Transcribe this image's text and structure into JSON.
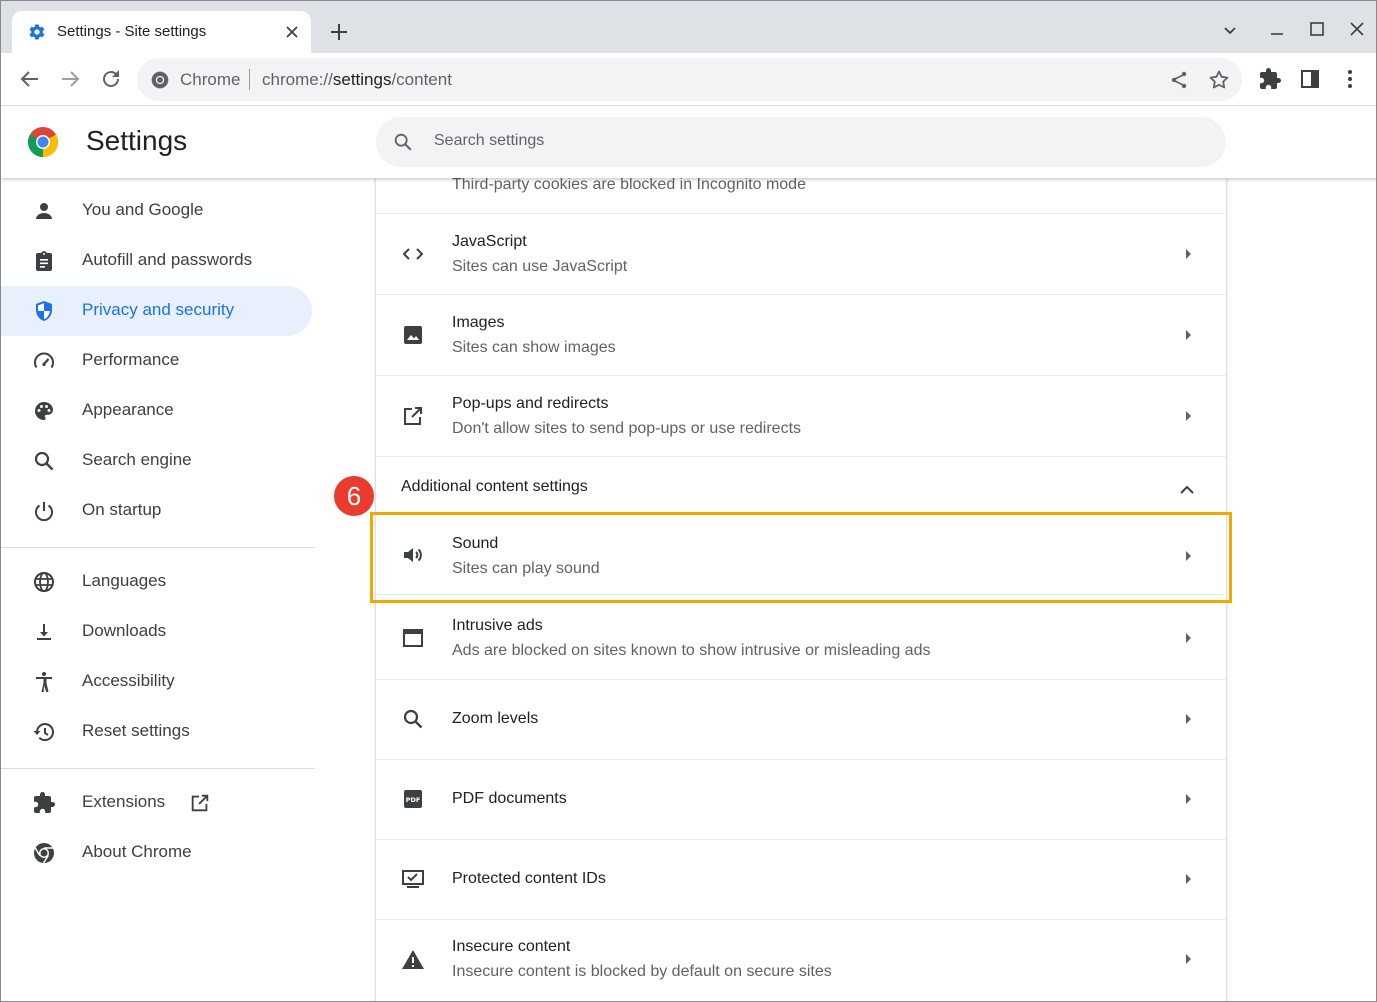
{
  "browser": {
    "tab_title": "Settings - Site settings",
    "omnibox_chip": "Chrome",
    "url_scheme": "chrome://",
    "url_host": "settings",
    "url_path": "/content"
  },
  "header": {
    "title": "Settings",
    "search_placeholder": "Search settings"
  },
  "sidebar": {
    "items": [
      {
        "label": "You and Google",
        "icon": "person-icon"
      },
      {
        "label": "Autofill and passwords",
        "icon": "clipboard-icon"
      },
      {
        "label": "Privacy and security",
        "icon": "shield-icon",
        "active": true
      },
      {
        "label": "Performance",
        "icon": "speedometer-icon"
      },
      {
        "label": "Appearance",
        "icon": "palette-icon"
      },
      {
        "label": "Search engine",
        "icon": "search-icon"
      },
      {
        "label": "On startup",
        "icon": "power-icon"
      },
      {
        "label": "Languages",
        "icon": "globe-icon"
      },
      {
        "label": "Downloads",
        "icon": "download-icon"
      },
      {
        "label": "Accessibility",
        "icon": "accessibility-icon"
      },
      {
        "label": "Reset settings",
        "icon": "restore-icon"
      },
      {
        "label": "Extensions",
        "icon": "puzzle-icon"
      },
      {
        "label": "About Chrome",
        "icon": "chrome-icon"
      }
    ]
  },
  "content": {
    "partial_row_sub": "Third-party cookies are blocked in Incognito mode",
    "rows": [
      {
        "title": "JavaScript",
        "sub": "Sites can use JavaScript",
        "icon": "code-icon"
      },
      {
        "title": "Images",
        "sub": "Sites can show images",
        "icon": "image-icon"
      },
      {
        "title": "Pop-ups and redirects",
        "sub": "Don't allow sites to send pop-ups or use redirects",
        "icon": "open-in-new-icon"
      }
    ],
    "section_title": "Additional content settings",
    "additional_rows": [
      {
        "title": "Sound",
        "sub": "Sites can play sound",
        "icon": "volume-icon"
      },
      {
        "title": "Intrusive ads",
        "sub": "Ads are blocked on sites known to show intrusive or misleading ads",
        "icon": "web-asset-icon"
      },
      {
        "title": "Zoom levels",
        "sub": "",
        "icon": "zoom-icon"
      },
      {
        "title": "PDF documents",
        "sub": "",
        "icon": "pdf-icon"
      },
      {
        "title": "Protected content IDs",
        "sub": "",
        "icon": "protected-content-icon"
      },
      {
        "title": "Insecure content",
        "sub": "Insecure content is blocked by default on secure sites",
        "icon": "warning-icon"
      }
    ]
  },
  "annotation": {
    "step_number": "6",
    "highlight_color": "#f3a800",
    "badge_color": "#ea3b2e"
  },
  "colors": {
    "accent": "#1a73e8",
    "active_bg": "#e8f0fe"
  }
}
